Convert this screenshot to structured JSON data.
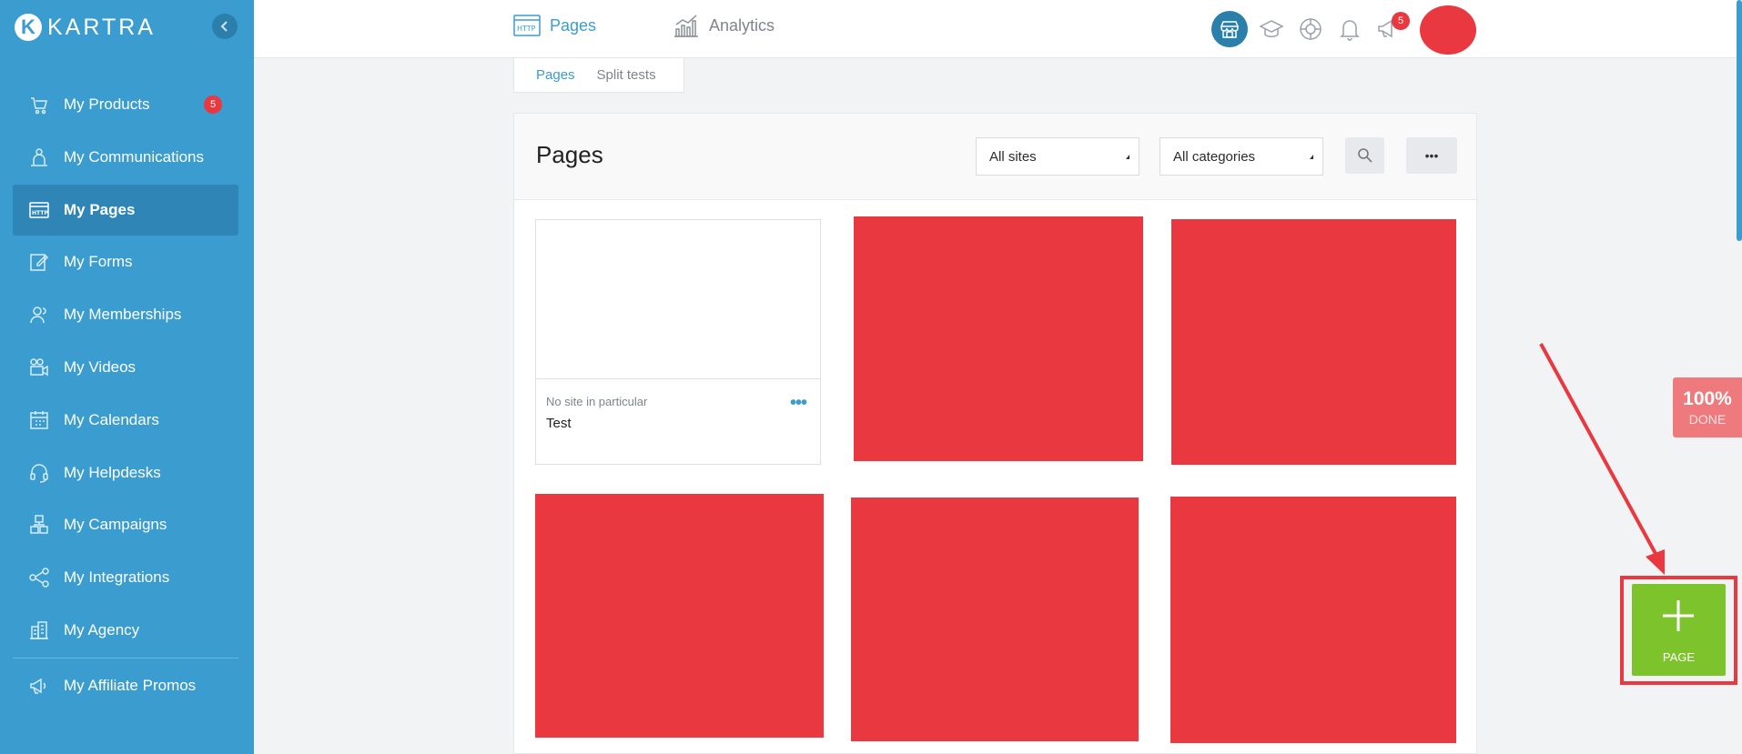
{
  "brand": {
    "name": "KARTRA",
    "mark": "K"
  },
  "sidebar": {
    "items": [
      {
        "label": "My Products",
        "badge": "5"
      },
      {
        "label": "My Communications"
      },
      {
        "label": "My Pages",
        "active": true
      },
      {
        "label": "My Forms"
      },
      {
        "label": "My Memberships"
      },
      {
        "label": "My Videos"
      },
      {
        "label": "My Calendars"
      },
      {
        "label": "My Helpdesks"
      },
      {
        "label": "My Campaigns"
      },
      {
        "label": "My Integrations"
      },
      {
        "label": "My Agency"
      },
      {
        "label": "My Affiliate Promos"
      }
    ]
  },
  "topbar": {
    "tabs": [
      {
        "label": "Pages",
        "icon": "http-icon"
      },
      {
        "label": "Analytics",
        "icon": "analytics-icon"
      }
    ],
    "notification_badge": "5"
  },
  "subtabs": [
    {
      "label": "Pages"
    },
    {
      "label": "Split tests"
    }
  ],
  "panel": {
    "title": "Pages",
    "filters": {
      "sites": "All sites",
      "categories": "All categories"
    },
    "more_label": "•••"
  },
  "cards": [
    {
      "site": "No site in particular",
      "name": "Test",
      "menu": "•••"
    }
  ],
  "progress": {
    "percent": "100%",
    "label": "DONE"
  },
  "add_button": {
    "label": "PAGE"
  },
  "colors": {
    "primary": "#3a9ccf",
    "accent_red": "#e9383f",
    "add_green": "#7dc42c"
  }
}
